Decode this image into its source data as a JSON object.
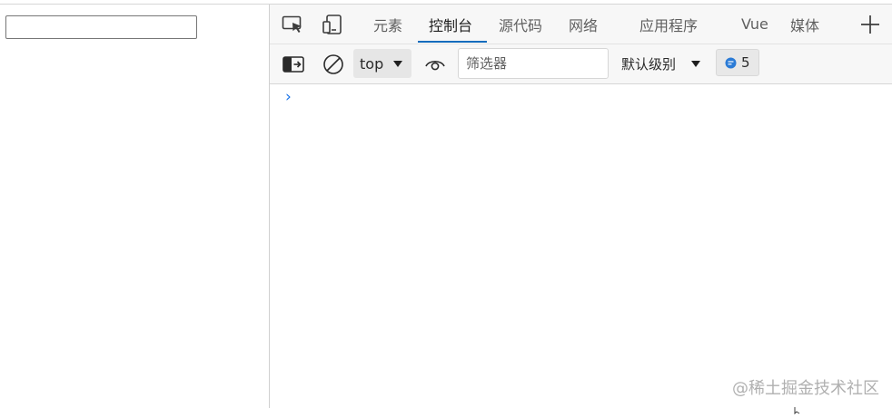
{
  "page": {
    "input_value": ""
  },
  "devtools": {
    "tabs": [
      {
        "label": "元素"
      },
      {
        "label": "控制台"
      },
      {
        "label": "源代码"
      },
      {
        "label": "网络"
      },
      {
        "label": "应用程序"
      },
      {
        "label": "Vue"
      },
      {
        "label": "媒体"
      }
    ],
    "active_tab": "控制台",
    "toolbar": {
      "context": "top",
      "filter_placeholder": "筛选器",
      "level": "默认级别",
      "issues_count": "5"
    },
    "console_prompt": "›",
    "accent_color": "#0f6cbd",
    "prompt_color": "#1a73e8",
    "issues_icon_color": "#2b7bd6"
  },
  "watermark": {
    "text": "@稀土掘金技术社区"
  },
  "icons": {
    "inspect": "inspect-element-icon",
    "device": "device-emulation-icon",
    "add_tab": "plus-icon",
    "sidebar": "sidebar-toggle-icon",
    "clear": "clear-console-icon",
    "live_expression": "eye-icon",
    "issues": "message-icon"
  }
}
